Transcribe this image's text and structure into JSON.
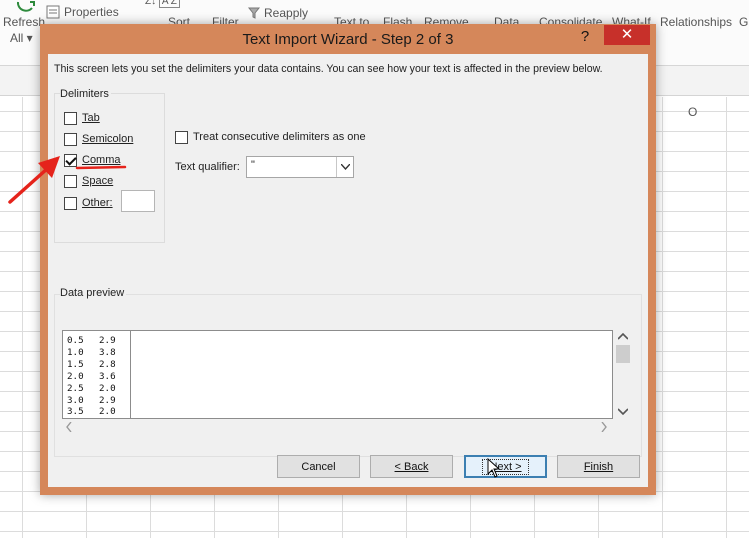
{
  "ribbon": {
    "refresh_label": "Refresh",
    "refresh_all_label": "All",
    "properties_label": "Properties",
    "sort_label": "Sort",
    "filter_label": "Filter",
    "reapply_label": "Reapply",
    "text_to_label": "Text to",
    "flash_label": "Flash",
    "remove_label": "Remove",
    "data_label": "Data",
    "consolidate_label": "Consolidate",
    "what_if_label": "What-If",
    "relationships_label": "Relationships",
    "cut_label": "G"
  },
  "sheet": {
    "column_header": "O"
  },
  "dialog": {
    "title": "Text Import Wizard - Step 2 of 3",
    "help_label": "?",
    "close_label": "✕",
    "intro": "This screen lets you set the delimiters your data contains.  You can see how your text is affected in the preview below.",
    "delimiters": {
      "group_label": "Delimiters",
      "tab": {
        "label": "Tab",
        "checked": false
      },
      "semicolon": {
        "label": "Semicolon",
        "checked": false
      },
      "comma": {
        "label": "Comma",
        "checked": true
      },
      "space": {
        "label": "Space",
        "checked": false
      },
      "other": {
        "label": "Other:",
        "checked": false,
        "value": ""
      }
    },
    "consecutive": {
      "label": "Treat consecutive delimiters as one",
      "checked": false
    },
    "text_qualifier": {
      "label": "Text qualifier:",
      "value": "\""
    },
    "preview": {
      "label": "Data preview",
      "rows": [
        [
          "0.5",
          "2.9"
        ],
        [
          "1.0",
          "3.8"
        ],
        [
          "1.5",
          "2.8"
        ],
        [
          "2.0",
          "3.6"
        ],
        [
          "2.5",
          "2.0"
        ],
        [
          "3.0",
          "2.9"
        ],
        [
          "3.5",
          "2.0"
        ]
      ]
    },
    "buttons": {
      "cancel": "Cancel",
      "back": "< Back",
      "next": "Next >",
      "finish": "Finish"
    }
  },
  "colors": {
    "dialog_frame": "#d5875a",
    "close_button": "#c7302a",
    "default_button_border": "#3c7fb1",
    "annotation_red": "#e5231b"
  }
}
